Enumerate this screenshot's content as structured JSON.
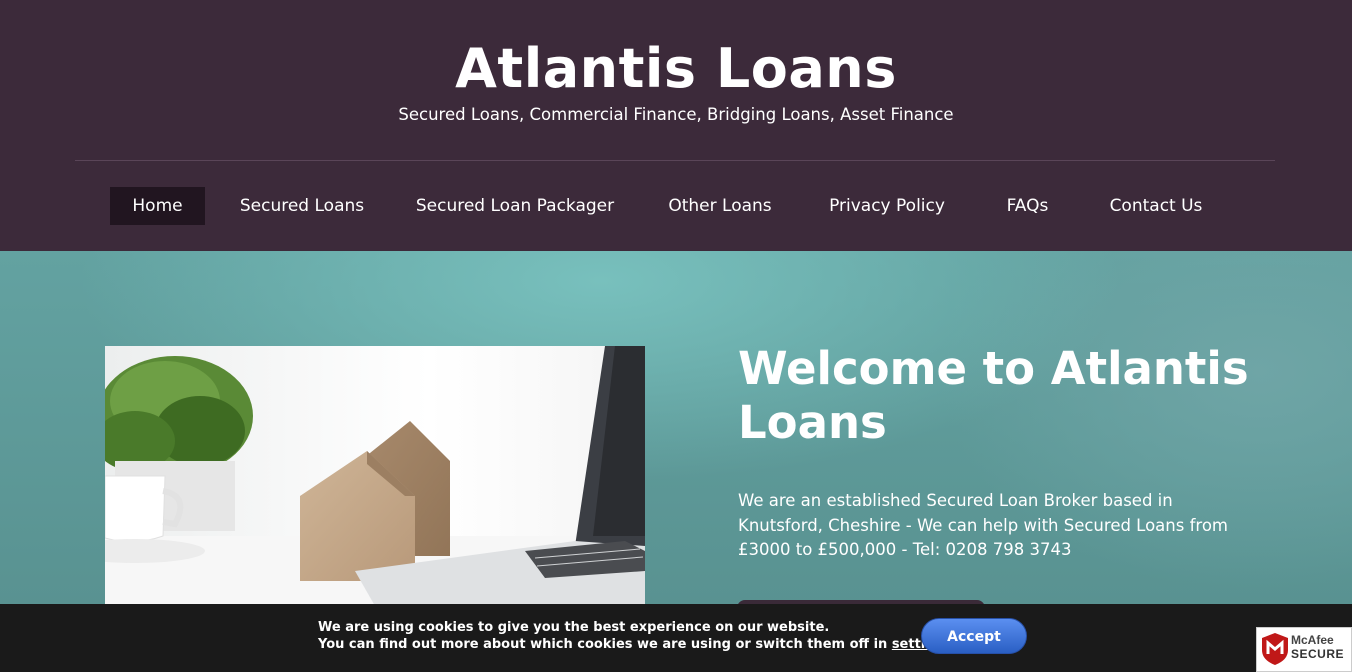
{
  "header": {
    "title": "Atlantis Loans",
    "tagline": "Secured Loans, Commercial Finance, Bridging Loans, Asset Finance"
  },
  "nav": {
    "items": [
      {
        "label": "Home",
        "active": true
      },
      {
        "label": "Secured Loans"
      },
      {
        "label": "Secured Loan Packager"
      },
      {
        "label": "Other Loans"
      },
      {
        "label": "Privacy Policy"
      },
      {
        "label": "FAQs"
      },
      {
        "label": "Contact Us"
      }
    ]
  },
  "hero": {
    "title": "Welcome to Atlantis Loans",
    "text": "We are an established Secured Loan Broker based in Knutsford, Cheshire - We can help with Secured Loans from £3000 to £500,000 - Tel: 0208 798 3743"
  },
  "cookie": {
    "line1": "We are using cookies to give you the best experience on our website.",
    "line2_prefix": "You can find out more about which cookies we are using or switch them off in ",
    "settings_link": "settings",
    "line2_suffix": ".",
    "accept_label": "Accept"
  },
  "badge": {
    "brand": "McAfee",
    "secure": "SECURE"
  },
  "colors": {
    "header_bg": "#3c2a3a",
    "nav_active_bg": "#211520",
    "hero_bg": "#5d9494",
    "accept_button": "#3f73d8",
    "cookie_bar_bg": "#1a1a1a"
  }
}
